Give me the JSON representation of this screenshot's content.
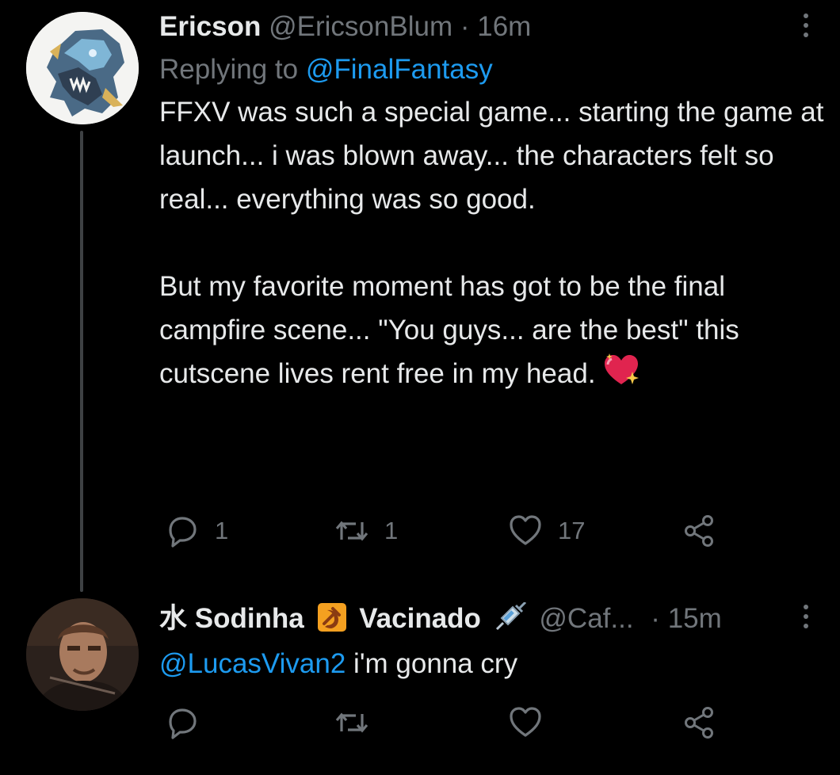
{
  "tweets": [
    {
      "author_name": "Ericson",
      "handle": "@EricsonBlum",
      "time": "16m",
      "replying_prefix": "Replying to",
      "replying_to": "@FinalFantasy",
      "paragraph_1": "FFXV was such a special game... starting the game at launch... i was blown away... the characters felt so real... everything was so good.",
      "paragraph_2": "But my favorite moment has got to be the final campfire scene... \"You guys... are the best\" this cutscene lives rent free in my head.",
      "emoji": "sparkling-heart",
      "replies": "1",
      "retweets": "1",
      "likes": "17"
    },
    {
      "author_name_part1": "水 Sodinha",
      "badge_icon": "hammer-sickle-emoji",
      "author_name_part2": "Vacinado",
      "syringe_icon": "syringe-emoji",
      "handle": "@Caf...",
      "time": "15m",
      "mention": "@LucasVivan2",
      "text": "i'm gonna cry"
    }
  ],
  "colors": {
    "background": "#000000",
    "primary_text": "#e7e9ea",
    "secondary_text": "#71767b",
    "link": "#1d9bf0",
    "thread_line": "#3e4144"
  }
}
